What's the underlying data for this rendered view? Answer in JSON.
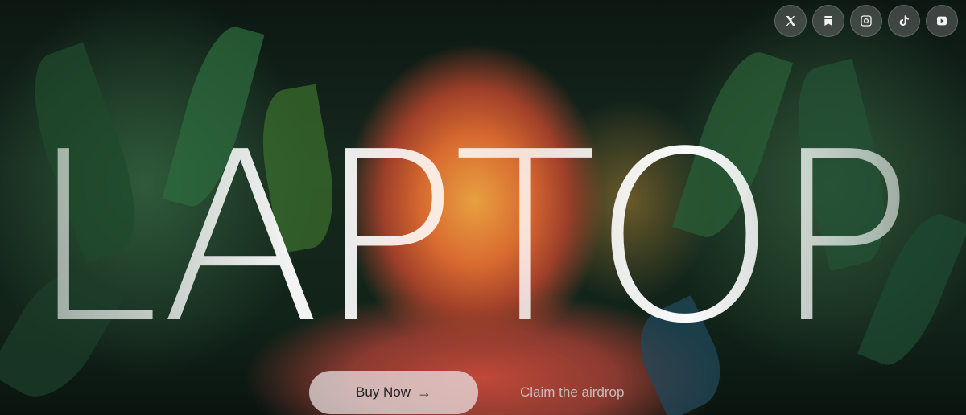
{
  "hero": {
    "title": "LAPTOP"
  },
  "social": [
    {
      "name": "x-icon",
      "glyph": "𝕏"
    },
    {
      "name": "bookmark-icon",
      "glyph": ""
    },
    {
      "name": "instagram-icon",
      "glyph": ""
    },
    {
      "name": "tiktok-icon",
      "glyph": ""
    },
    {
      "name": "youtube-icon",
      "glyph": ""
    }
  ],
  "cta": {
    "buy_label": "Buy Now",
    "buy_arrow": "→",
    "claim_label": "Claim the airdrop"
  },
  "colors": {
    "background": "#0a1410",
    "button_bg": "#ebe6e8",
    "title": "#ffffff"
  }
}
